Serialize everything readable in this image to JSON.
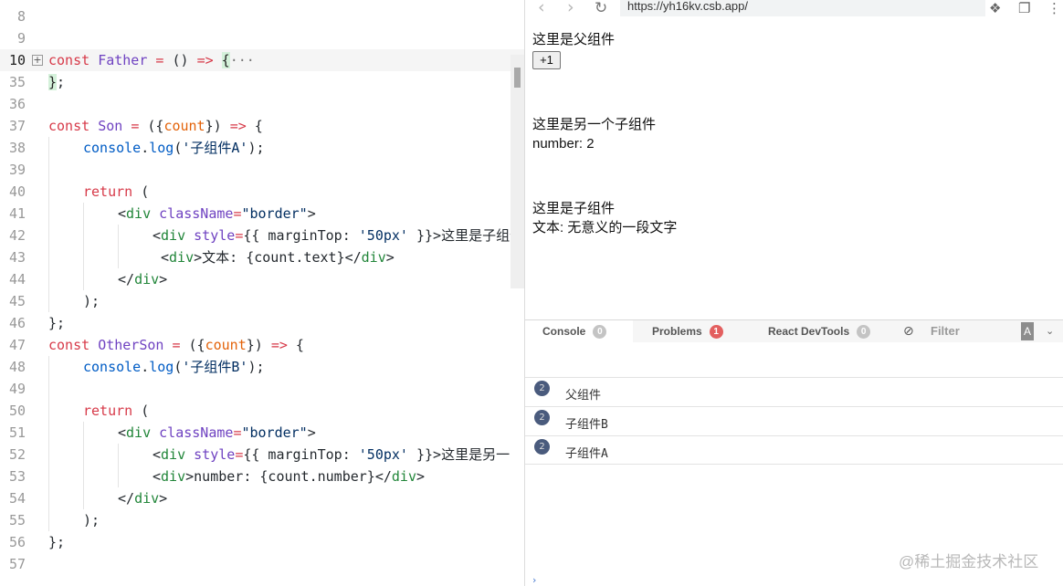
{
  "editor": {
    "fold_marker": "+",
    "fold_ellipsis": "···",
    "lines": [
      {
        "num": "8",
        "tokens": []
      },
      {
        "num": "9",
        "tokens": []
      },
      {
        "num": "10",
        "active": true,
        "fold": true,
        "tokens": [
          [
            "kw",
            "const "
          ],
          [
            "fn",
            "Father"
          ],
          [
            "pl",
            " "
          ],
          [
            "kw",
            "="
          ],
          [
            "pl",
            " () "
          ],
          [
            "kw",
            "=>"
          ],
          [
            "pl",
            " "
          ],
          [
            "brace-hl",
            "{"
          ],
          [
            "fold",
            "···"
          ]
        ]
      },
      {
        "num": "35",
        "tokens": [
          [
            "brace-hl",
            "}"
          ],
          [
            "pl",
            ";"
          ]
        ]
      },
      {
        "num": "36",
        "tokens": []
      },
      {
        "num": "37",
        "tokens": [
          [
            "kw",
            "const "
          ],
          [
            "fn",
            "Son"
          ],
          [
            "pl",
            " "
          ],
          [
            "kw",
            "="
          ],
          [
            "pl",
            " ({"
          ],
          [
            "param",
            "count"
          ],
          [
            "pl",
            "}) "
          ],
          [
            "kw",
            "=>"
          ],
          [
            "pl",
            " {"
          ]
        ]
      },
      {
        "num": "38",
        "indent": 1,
        "tokens": [
          [
            "prop",
            "console"
          ],
          [
            "pl",
            "."
          ],
          [
            "prop",
            "log"
          ],
          [
            "pl",
            "("
          ],
          [
            "str",
            "'子组件A'"
          ],
          [
            "pl",
            ");"
          ]
        ]
      },
      {
        "num": "39",
        "guides": 1,
        "tokens": []
      },
      {
        "num": "40",
        "indent": 1,
        "tokens": [
          [
            "kw",
            "return"
          ],
          [
            "pl",
            " ("
          ]
        ]
      },
      {
        "num": "41",
        "indent": 2,
        "tokens": [
          [
            "pl",
            "<"
          ],
          [
            "tag",
            "div"
          ],
          [
            "pl",
            " "
          ],
          [
            "attr",
            "className"
          ],
          [
            "kw",
            "="
          ],
          [
            "str",
            "\"border\""
          ],
          [
            "pl",
            ">"
          ]
        ]
      },
      {
        "num": "42",
        "indent": 3,
        "tokens": [
          [
            "pl",
            "<"
          ],
          [
            "tag",
            "div"
          ],
          [
            "pl",
            " "
          ],
          [
            "attr",
            "style"
          ],
          [
            "kw",
            "="
          ],
          [
            "pl",
            "{{ marginTop: "
          ],
          [
            "str",
            "'50px'"
          ],
          [
            "pl",
            " }}>这里是子组件"
          ]
        ]
      },
      {
        "num": "43",
        "indent": 3,
        "extra": " ",
        "tokens": [
          [
            "pl",
            "<"
          ],
          [
            "tag",
            "div"
          ],
          [
            "pl",
            ">文本: {count.text}</"
          ],
          [
            "tag",
            "div"
          ],
          [
            "pl",
            ">"
          ]
        ]
      },
      {
        "num": "44",
        "indent": 2,
        "tokens": [
          [
            "pl",
            "</"
          ],
          [
            "tag",
            "div"
          ],
          [
            "pl",
            ">"
          ]
        ]
      },
      {
        "num": "45",
        "indent": 1,
        "tokens": [
          [
            "pl",
            ");"
          ]
        ]
      },
      {
        "num": "46",
        "tokens": [
          [
            "pl",
            "};"
          ]
        ]
      },
      {
        "num": "47",
        "tokens": [
          [
            "kw",
            "const "
          ],
          [
            "fn",
            "OtherSon"
          ],
          [
            "pl",
            " "
          ],
          [
            "kw",
            "="
          ],
          [
            "pl",
            " ({"
          ],
          [
            "param",
            "count"
          ],
          [
            "pl",
            "}) "
          ],
          [
            "kw",
            "=>"
          ],
          [
            "pl",
            " {"
          ]
        ]
      },
      {
        "num": "48",
        "indent": 1,
        "tokens": [
          [
            "prop",
            "console"
          ],
          [
            "pl",
            "."
          ],
          [
            "prop",
            "log"
          ],
          [
            "pl",
            "("
          ],
          [
            "str",
            "'子组件B'"
          ],
          [
            "pl",
            ");"
          ]
        ]
      },
      {
        "num": "49",
        "guides": 1,
        "tokens": []
      },
      {
        "num": "50",
        "indent": 1,
        "tokens": [
          [
            "kw",
            "return"
          ],
          [
            "pl",
            " ("
          ]
        ]
      },
      {
        "num": "51",
        "indent": 2,
        "tokens": [
          [
            "pl",
            "<"
          ],
          [
            "tag",
            "div"
          ],
          [
            "pl",
            " "
          ],
          [
            "attr",
            "className"
          ],
          [
            "kw",
            "="
          ],
          [
            "str",
            "\"border\""
          ],
          [
            "pl",
            ">"
          ]
        ]
      },
      {
        "num": "52",
        "indent": 3,
        "tokens": [
          [
            "pl",
            "<"
          ],
          [
            "tag",
            "div"
          ],
          [
            "pl",
            " "
          ],
          [
            "attr",
            "style"
          ],
          [
            "kw",
            "="
          ],
          [
            "pl",
            "{{ marginTop: "
          ],
          [
            "str",
            "'50px'"
          ],
          [
            "pl",
            " }}>这里是另一"
          ]
        ]
      },
      {
        "num": "53",
        "indent": 3,
        "tokens": [
          [
            "pl",
            "<"
          ],
          [
            "tag",
            "div"
          ],
          [
            "pl",
            ">number: {count.number}</"
          ],
          [
            "tag",
            "div"
          ],
          [
            "pl",
            ">"
          ]
        ]
      },
      {
        "num": "54",
        "indent": 2,
        "tokens": [
          [
            "pl",
            "</"
          ],
          [
            "tag",
            "div"
          ],
          [
            "pl",
            ">"
          ]
        ]
      },
      {
        "num": "55",
        "indent": 1,
        "tokens": [
          [
            "pl",
            ");"
          ]
        ]
      },
      {
        "num": "56",
        "tokens": [
          [
            "pl",
            "};"
          ]
        ]
      },
      {
        "num": "57",
        "tokens": []
      }
    ]
  },
  "browser": {
    "back_icon": "back-arrow-icon",
    "back_glyph": "‹",
    "forward_icon": "forward-arrow-icon",
    "forward_glyph": "›",
    "reload_icon": "reload-icon",
    "reload_glyph": "↻",
    "url": "https://yh16kv.csb.app/",
    "ext_glyph": "❖",
    "copy_glyph": "❐",
    "menu_glyph": "⋮"
  },
  "preview": {
    "father_label": "这里是父组件",
    "increment_button": "+1",
    "other_son_label": "这里是另一个子组件",
    "number_line": "number: 2",
    "son_label": "这里是子组件",
    "text_line": "文本: 无意义的一段文字"
  },
  "devtools": {
    "tabs": [
      {
        "label": "Console",
        "count": "0",
        "badge": "grey"
      },
      {
        "label": "Problems",
        "count": "1",
        "badge": "red"
      },
      {
        "label": "React DevTools",
        "count": "0",
        "badge": "grey"
      }
    ],
    "filter_glyph": "⊘",
    "filter_placeholder": "Filter",
    "level_glyph": "A",
    "chevron_glyph": "⌄",
    "logs": [
      {
        "count": "2",
        "text": "父组件"
      },
      {
        "count": "2",
        "text": "子组件B"
      },
      {
        "count": "2",
        "text": "子组件A"
      }
    ],
    "prompt": "›"
  },
  "watermark": "@稀土掘金技术社区"
}
